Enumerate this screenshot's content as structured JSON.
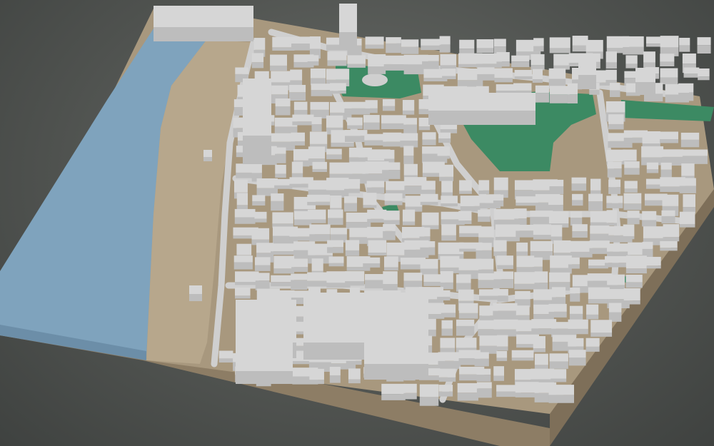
{
  "scene": {
    "type": "3d-city-model",
    "background_color": "#5a5d5a",
    "colors": {
      "water": "#7fa3bd",
      "water_edge": "#6c8ea8",
      "beach": "#b7a78c",
      "ground": "#a8987e",
      "base_side": "#7e6f59",
      "base_front": "#8d7d65",
      "building_top": "#d6d6d6",
      "building_side": "#bdbdbd",
      "building_dark": "#a9a9a9",
      "street": "#cfcfcf",
      "park": "#3c8a63",
      "park_dark": "#2f7553"
    },
    "layers": [
      "water",
      "beach",
      "streets",
      "buildings",
      "parks"
    ]
  }
}
